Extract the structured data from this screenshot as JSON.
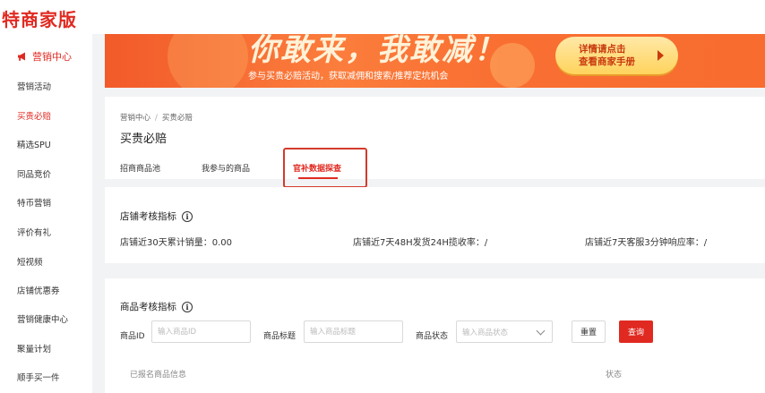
{
  "app": {
    "logo_text": "特商家版"
  },
  "sidebar": {
    "header": {
      "label": "营销中心",
      "icon": "megaphone-icon"
    },
    "items": [
      {
        "label": "营销活动"
      },
      {
        "label": "买贵必赔",
        "active": true
      },
      {
        "label": "精选SPU"
      },
      {
        "label": "同品竞价"
      },
      {
        "label": "特币营销"
      },
      {
        "label": "评价有礼"
      },
      {
        "label": "短视频"
      },
      {
        "label": "店铺优惠券"
      },
      {
        "label": "营销健康中心"
      },
      {
        "label": "聚量计划"
      },
      {
        "label": "顺手买一件"
      }
    ]
  },
  "banner": {
    "headline": "你敢来，我敢减！",
    "subline": "参与买贵必赔活动，获取减佣和搜索/推荐定坑机会",
    "cta_line1": "详情请点击",
    "cta_line2": "查看商家手册"
  },
  "header": {
    "breadcrumb": [
      "营销中心",
      "买贵必赔"
    ],
    "breadcrumb_sep": "/",
    "title": "买贵必赔",
    "tabs": [
      {
        "label": "招商商品池"
      },
      {
        "label": "我参与的商品"
      },
      {
        "label": "官补数据探查",
        "active": true
      }
    ]
  },
  "shop_metrics": {
    "title": "店铺考核指标",
    "items": [
      {
        "label": "店铺近30天累计销量：0.00"
      },
      {
        "label": "店铺近7天48H发货24H揽收率：/"
      },
      {
        "label": "店铺近7天客服3分钟响应率：/"
      }
    ]
  },
  "product_metrics": {
    "title": "商品考核指标",
    "filters": {
      "product_id_label": "商品ID",
      "product_id_placeholder": "输入商品ID",
      "product_title_label": "商品标题",
      "product_title_placeholder": "输入商品标题",
      "status_label": "商品状态",
      "status_placeholder": "输入商品状态"
    },
    "buttons": {
      "reset": "重置",
      "query": "查询"
    },
    "table_columns": [
      "已报名商品信息",
      "状态"
    ]
  },
  "colors": {
    "accent": "#e02a21",
    "banner": "#f86c2f"
  }
}
